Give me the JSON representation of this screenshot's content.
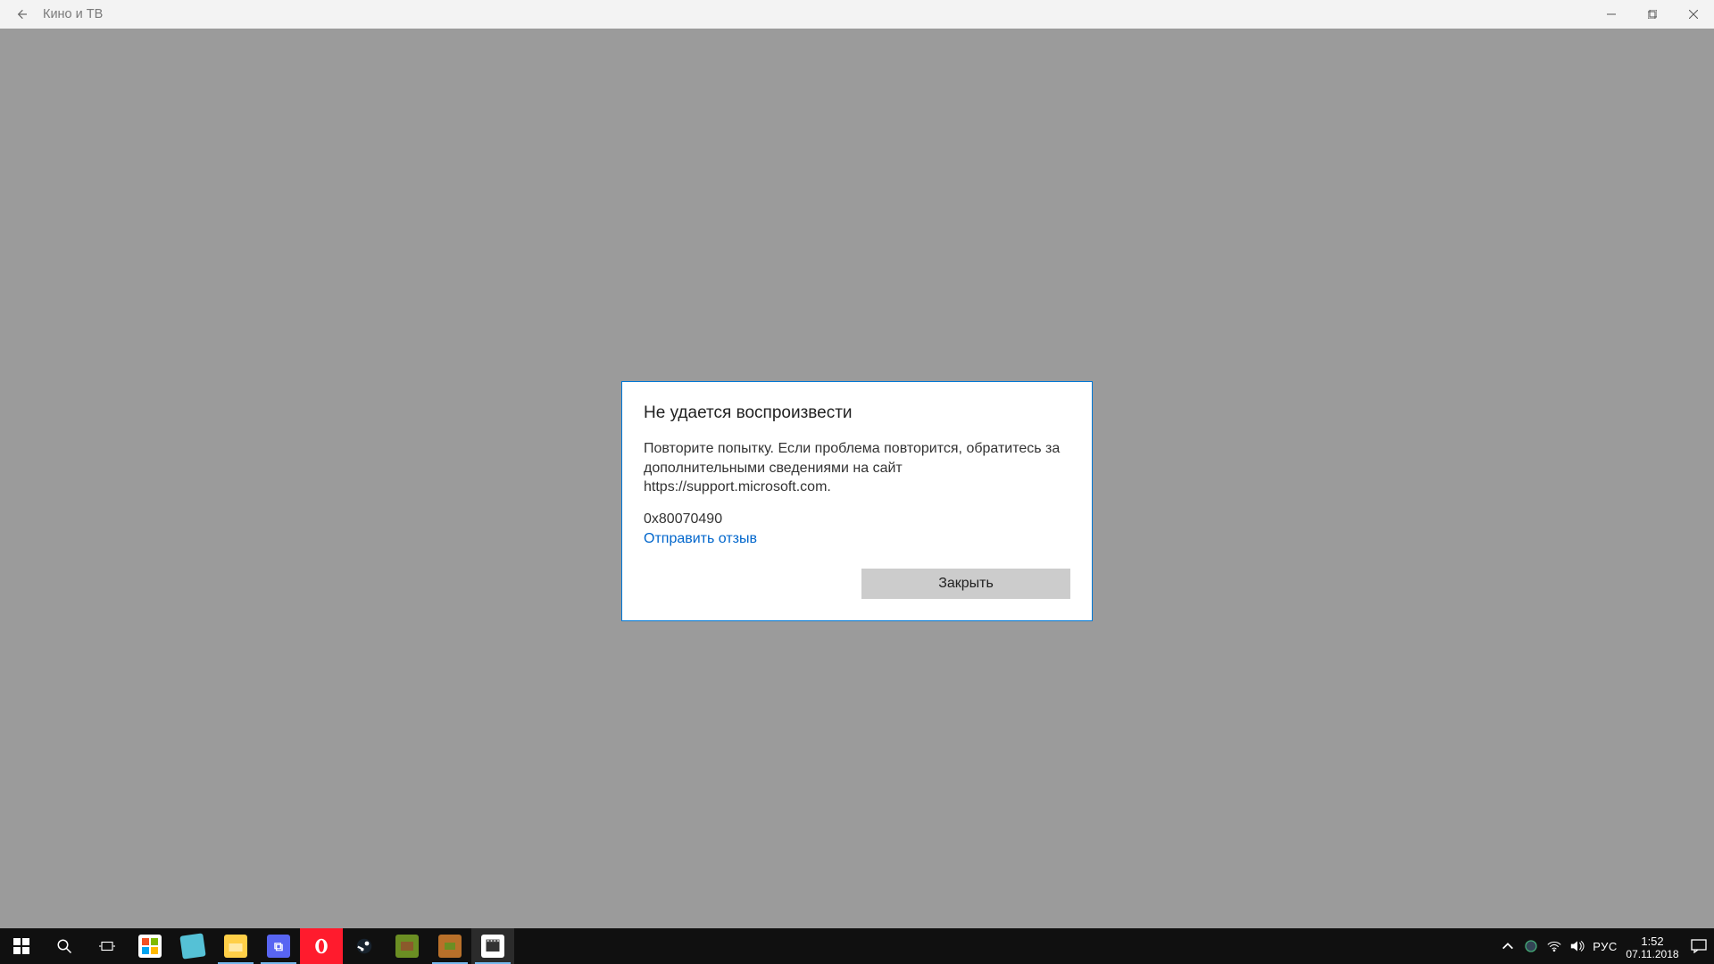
{
  "window": {
    "title": "Кино и ТВ"
  },
  "dialog": {
    "title": "Не удается воспроизвести",
    "message": "Повторите попытку. Если проблема повторится, обратитесь за дополнительными сведениями на сайт https://support.microsoft.com.",
    "error_code": "0x80070490",
    "feedback_link": "Отправить отзыв",
    "close_button": "Закрыть"
  },
  "taskbar": {
    "apps": [
      {
        "name": "start",
        "open": false
      },
      {
        "name": "search",
        "open": false
      },
      {
        "name": "task-view",
        "open": false
      },
      {
        "name": "store",
        "open": false
      },
      {
        "name": "notes",
        "open": false
      },
      {
        "name": "file-explorer",
        "open": true
      },
      {
        "name": "discord",
        "open": true
      },
      {
        "name": "opera",
        "open": false
      },
      {
        "name": "steam",
        "open": false
      },
      {
        "name": "minecraft",
        "open": false
      },
      {
        "name": "minecraft-box",
        "open": true
      },
      {
        "name": "movies-tv",
        "open": true,
        "active": true
      }
    ],
    "tray": {
      "language": "РУС",
      "time": "1:52",
      "date": "07.11.2018"
    }
  }
}
